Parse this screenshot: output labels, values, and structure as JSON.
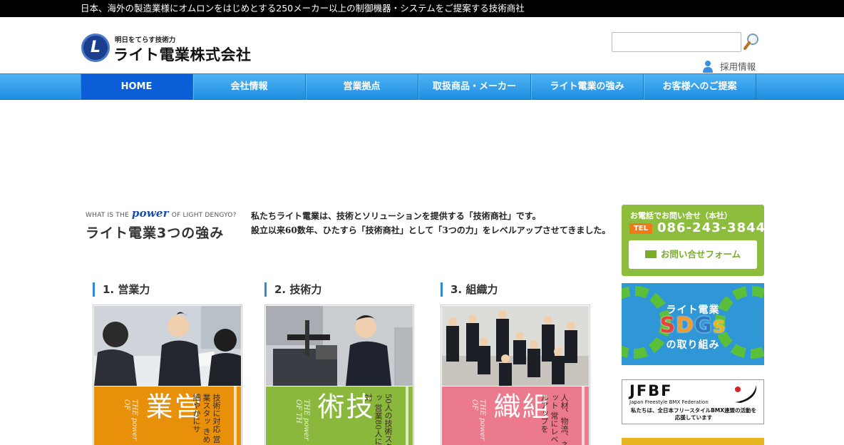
{
  "topbar": {
    "text": "日本、海外の製造業様にオムロンをはじめとする250メーカー以上の制御機器・システムをご提案する技術商社"
  },
  "logo": {
    "tagline": "明日をてらす技術力",
    "name": "ライト電業株式会社",
    "mark": "L"
  },
  "search": {
    "placeholder": ""
  },
  "recruit": {
    "label": "採用情報"
  },
  "nav": {
    "items": [
      "HOME",
      "会社情報",
      "営業拠点",
      "取扱商品・メーカー",
      "ライト電業の強み",
      "お客様へのご提案"
    ],
    "active": 0
  },
  "power": {
    "en_prefix": "WHAT IS THE",
    "en_power": "power",
    "en_suffix": "OF LIGHT DENGYO?",
    "title": "ライト電業3つの強み"
  },
  "intro": {
    "line1": "私たちライト電業は、技術とソリューションを提供する「技術商社」です。",
    "line2": "設立以来60数年、ひたすら「技術商社」として「3つの力」をレベルアップさせてきました。"
  },
  "strengths": [
    {
      "heading": "1.  営業力",
      "big": "営業",
      "small": "技術に対応 営業スタッ きめ細やかにサ",
      "power": "THE power OF",
      "color": "#e8900a"
    },
    {
      "heading": "2.  技術力",
      "big": "技術",
      "small": "50人の技術スタッ 営業80人に対",
      "power": "THE power OF TH",
      "color": "#8ab83c"
    },
    {
      "heading": "3.  組織力",
      "big": "組織",
      "small": "人材、物流、ネット 常にレベルアップを",
      "power": "THE power OF",
      "color": "#ea7a8c"
    }
  ],
  "contact": {
    "label": "お電話でお問い合せ（本社）",
    "tel_badge": "TEL",
    "tel": "086-243-3844",
    "form_button": "お問い合せフォーム"
  },
  "sdgs": {
    "line1": "ライト電業",
    "line2": "SDGs",
    "line3": "の取り組み",
    "letter_colors": [
      "#e8413c",
      "#f29a2e",
      "#2e78c2",
      "#e9b418"
    ]
  },
  "jfbf": {
    "big": "JFBF",
    "sub": "Japan Freestyle BMX Federation",
    "note1": "私たちは、全日本フリースタイルBMX連盟の活動を",
    "note2": "応援しています"
  },
  "colors": {
    "nav_active": "#0b5dd8",
    "nav": "#2a9be8",
    "contact": "#8dbd3d",
    "accent_bar": "#2f8ad8"
  }
}
